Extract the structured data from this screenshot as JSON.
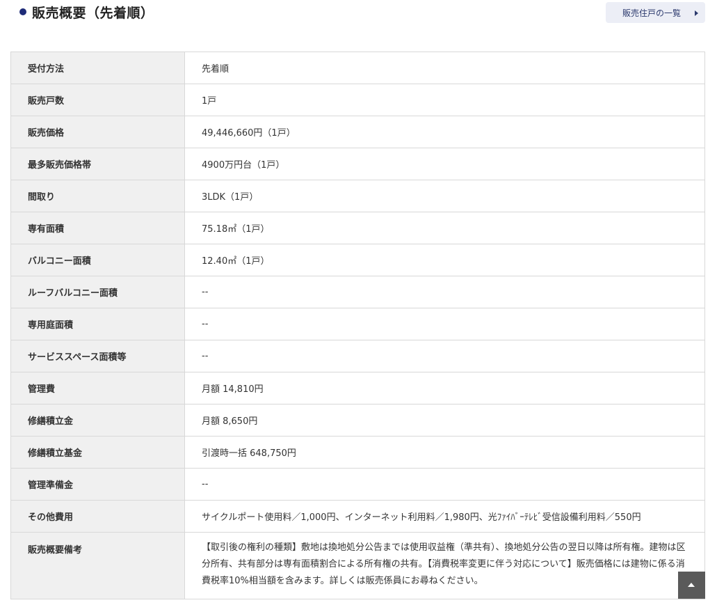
{
  "header": {
    "title": "販売概要（先着順）",
    "list_link_label": "販売住戸の一覧"
  },
  "spec": {
    "rows": [
      {
        "label": "受付方法",
        "value": "先着順"
      },
      {
        "label": "販売戸数",
        "value": "1戸"
      },
      {
        "label": "販売価格",
        "value": "49,446,660円（1戸）"
      },
      {
        "label": "最多販売価格帯",
        "value": "4900万円台（1戸）"
      },
      {
        "label": "間取り",
        "value": "3LDK（1戸）"
      },
      {
        "label": "専有面積",
        "value": "75.18㎡（1戸）"
      },
      {
        "label": "バルコニー面積",
        "value": "12.40㎡（1戸）"
      },
      {
        "label": "ルーフバルコニー面積",
        "value": "--"
      },
      {
        "label": "専用庭面積",
        "value": "--"
      },
      {
        "label": "サービススペース面積等",
        "value": "--"
      },
      {
        "label": "管理費",
        "value": "月額 14,810円"
      },
      {
        "label": "修繕積立金",
        "value": "月額 8,650円"
      },
      {
        "label": "修繕積立基金",
        "value": "引渡時一括 648,750円"
      },
      {
        "label": "管理準備金",
        "value": "--"
      },
      {
        "label": "その他費用",
        "value": "サイクルポート使用料／1,000円、インターネット利用料／1,980円、光ﾌｧｲﾊﾞｰﾃﾚﾋﾞ受信設備利用料／550円"
      },
      {
        "label": "販売概要備考",
        "value": "【取引後の権利の種類】敷地は換地処分公告までは使用収益権（準共有）、換地処分公告の翌日以降は所有権。建物は区分所有、共有部分は専有面積割合による所有権の共有。【消費税率変更に伴う対応について】販売価格には建物に係る消費税率10%相当額を含みます。詳しくは販売係員にお尋ねください。"
      }
    ]
  },
  "icons": {
    "heading_bullet": "bullet-dot-icon",
    "list_link_arrow": "triangle-right-icon",
    "page_top": "triangle-up-icon"
  },
  "colors": {
    "accent": "#1e2b78",
    "link_bg": "#eceef6",
    "header_cell_bg": "#f0f0f0",
    "page_top_bg": "#5a5a5a"
  }
}
